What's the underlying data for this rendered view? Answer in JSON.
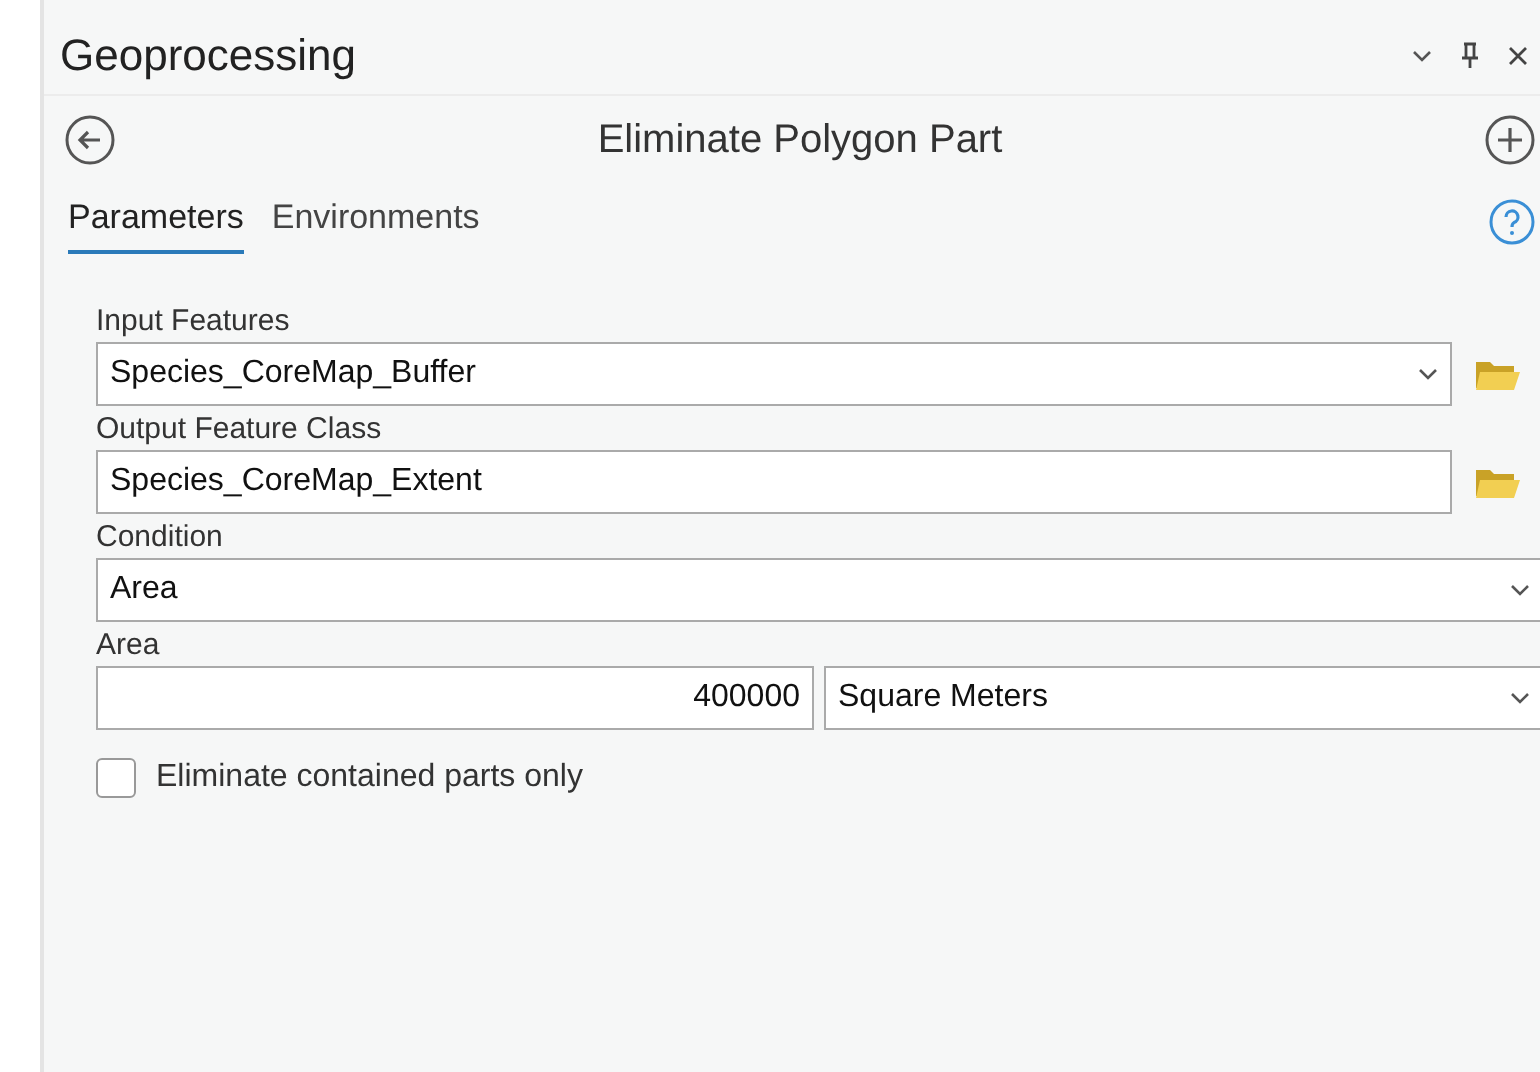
{
  "panel": {
    "title": "Geoprocessing"
  },
  "tool": {
    "title": "Eliminate Polygon Part"
  },
  "tabs": [
    {
      "label": "Parameters",
      "selected": true
    },
    {
      "label": "Environments",
      "selected": false
    }
  ],
  "parameters": [
    {
      "kind": "dropdown",
      "label": "Input Features",
      "value": "Species_CoreMap_Buffer",
      "browse": true
    },
    {
      "kind": "text",
      "label": "Output Feature Class",
      "value": "Species_CoreMap_Extent",
      "browse": true
    },
    {
      "kind": "dropdown",
      "label": "Condition",
      "value": "Area",
      "browse": false
    },
    {
      "kind": "linear",
      "label": "Area",
      "value": "400000",
      "unit": "Square Meters"
    },
    {
      "kind": "checkbox",
      "label": "Eliminate contained parts only",
      "checked": false
    }
  ]
}
